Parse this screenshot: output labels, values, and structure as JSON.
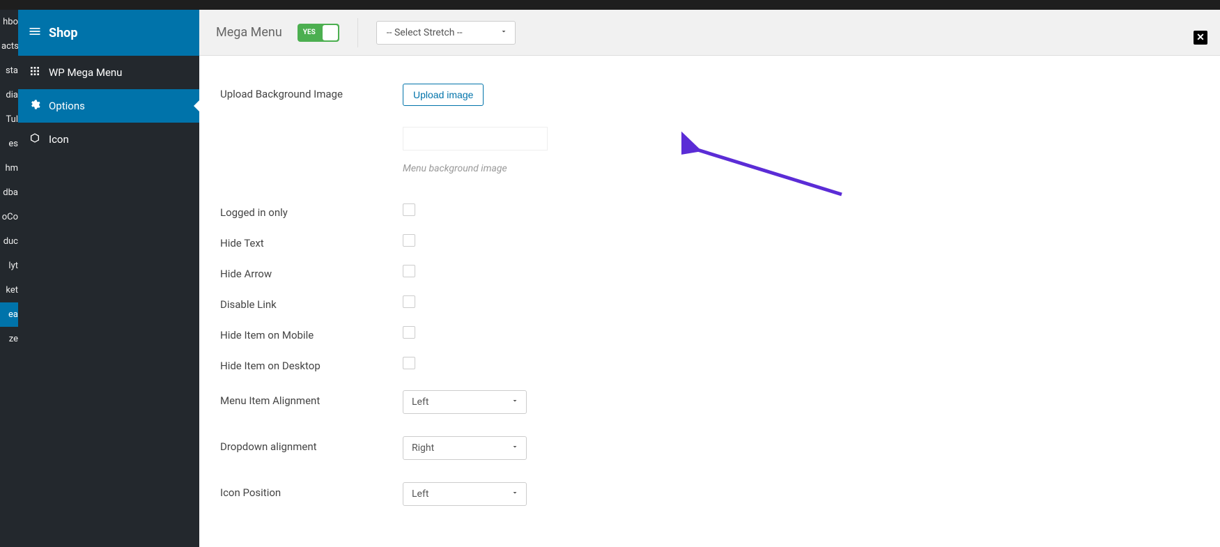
{
  "wp_sidebar_fragments": [
    "hbo",
    "acts",
    "sta",
    "dia",
    "Tul",
    "es",
    "hm",
    "dba",
    "oCo",
    "duc",
    "lyt",
    "ket",
    "ea",
    "ze"
  ],
  "wp_sidebar_active_index": 12,
  "sidebar": {
    "title": "Shop",
    "items": [
      {
        "label": "WP Mega Menu",
        "icon": "grid-icon"
      },
      {
        "label": "Options",
        "icon": "gear-icon"
      },
      {
        "label": "Icon",
        "icon": "cube-icon"
      }
    ],
    "active_index": 1
  },
  "topbar": {
    "title": "Mega Menu",
    "toggle_label": "YES",
    "stretch_placeholder": "-- Select Stretch --"
  },
  "form": {
    "upload_bg_label": "Upload Background Image",
    "upload_button": "Upload image",
    "upload_hint": "Menu background image",
    "rows": [
      {
        "label": "Logged in only"
      },
      {
        "label": "Hide Text"
      },
      {
        "label": "Hide Arrow"
      },
      {
        "label": "Disable Link"
      },
      {
        "label": "Hide Item on Mobile"
      },
      {
        "label": "Hide Item on Desktop"
      }
    ],
    "selects": [
      {
        "label": "Menu Item Alignment",
        "value": "Left"
      },
      {
        "label": "Dropdown alignment",
        "value": "Right"
      },
      {
        "label": "Icon Position",
        "value": "Left"
      }
    ]
  },
  "colors": {
    "accent": "#0073aa",
    "toggle_on": "#4caf50",
    "annotation_arrow": "#5b2cd6"
  }
}
